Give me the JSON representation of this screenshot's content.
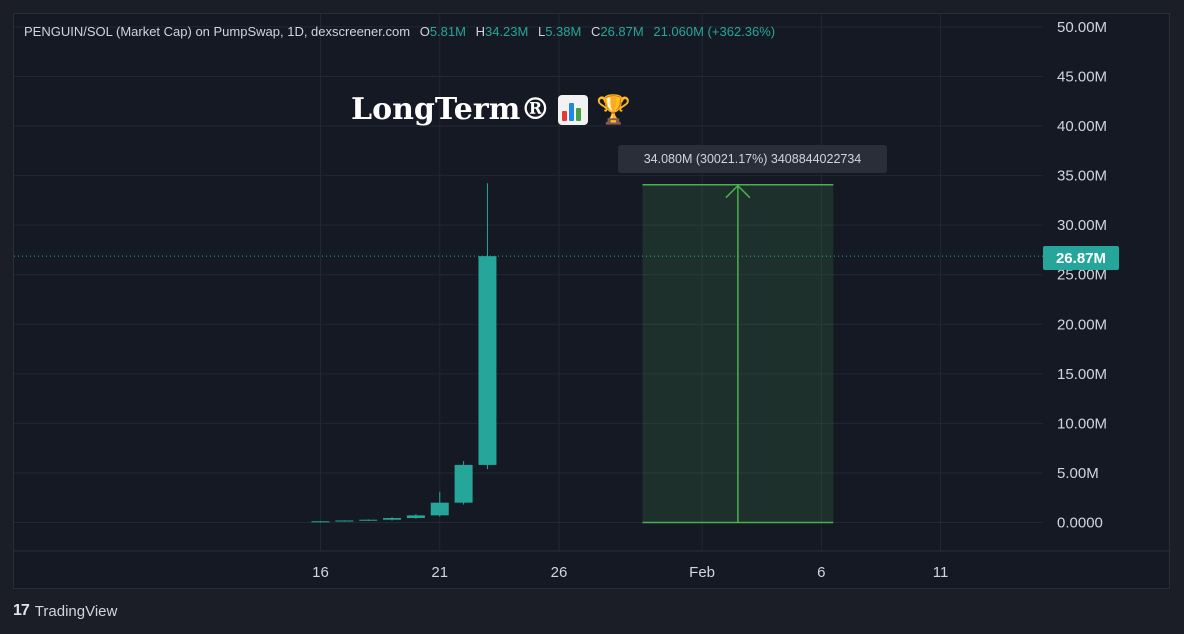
{
  "legend": {
    "symbol": "PENGUIN/SOL (Market Cap) on PumpSwap, 1D, dexscreener.com",
    "o_label": "O",
    "o_value": "5.81M",
    "h_label": "H",
    "h_value": "34.23M",
    "l_label": "L",
    "l_value": "5.38M",
    "c_label": "C",
    "c_value": "26.87M",
    "change": "21.060M (+362.36%)"
  },
  "annotation": {
    "text": "LongTerm®"
  },
  "measure_tooltip": {
    "text": "34.080M (30021.17%) 3408844022734"
  },
  "last_price_label": "26.87M",
  "branding": {
    "logo_mark": "17",
    "name": "TradingView"
  },
  "colors": {
    "up": "#26a69a",
    "down": "#ef5350",
    "measure": "#4caf50",
    "grid": "#232734",
    "text": "#d1d4dc"
  },
  "chart_data": {
    "type": "candlestick",
    "title": "PENGUIN/SOL (Market Cap) on PumpSwap, 1D, dexscreener.com",
    "ylim": [
      -2.4,
      51.5
    ],
    "y_ticks": [
      "50.00M",
      "45.00M",
      "40.00M",
      "35.00M",
      "30.00M",
      "25.00M",
      "20.00M",
      "15.00M",
      "10.00M",
      "5.00M",
      "0.0000"
    ],
    "y_tick_values": [
      50,
      45,
      40,
      35,
      30,
      25,
      20,
      15,
      10,
      5,
      0
    ],
    "x_ticks": [
      "16",
      "21",
      "26",
      "Feb",
      "6",
      "11"
    ],
    "x_tick_days": [
      16,
      21,
      26,
      32,
      37,
      42
    ],
    "unit": "M",
    "candles": [
      {
        "day": 16,
        "open": 0.05,
        "high": 0.15,
        "low": 0.02,
        "close": 0.12
      },
      {
        "day": 17,
        "open": 0.12,
        "high": 0.22,
        "low": 0.08,
        "close": 0.2
      },
      {
        "day": 18,
        "open": 0.2,
        "high": 0.32,
        "low": 0.15,
        "close": 0.28
      },
      {
        "day": 19,
        "open": 0.28,
        "high": 0.55,
        "low": 0.2,
        "close": 0.45
      },
      {
        "day": 20,
        "open": 0.45,
        "high": 0.85,
        "low": 0.38,
        "close": 0.72
      },
      {
        "day": 21,
        "open": 0.72,
        "high": 3.1,
        "low": 0.6,
        "close": 2.0
      },
      {
        "day": 22,
        "open": 2.0,
        "high": 6.2,
        "low": 1.8,
        "close": 5.81
      },
      {
        "day": 23,
        "open": 5.81,
        "high": 34.23,
        "low": 5.38,
        "close": 26.87
      }
    ],
    "last_price": 26.87,
    "measure": {
      "from_day": 29.5,
      "to_day": 37.5,
      "low": 0.0,
      "high": 34.08
    }
  }
}
